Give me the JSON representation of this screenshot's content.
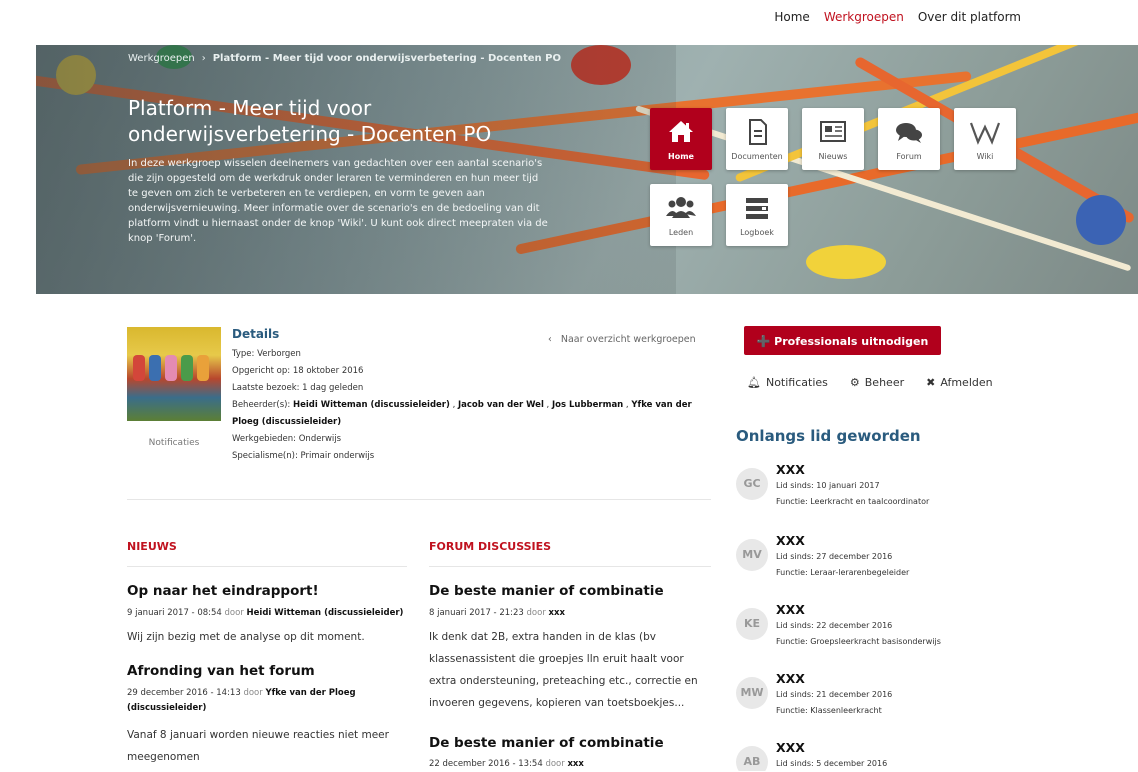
{
  "topnav": {
    "items": [
      "Home",
      "Werkgroepen",
      "Over dit platform"
    ],
    "active": "Werkgroepen"
  },
  "breadcrumb": {
    "root": "Werkgroepen",
    "separator": "›",
    "current": "Platform - Meer tijd voor onderwijsverbetering - Docenten PO"
  },
  "hero": {
    "title": "Platform - Meer tijd voor onderwijsverbetering - Docenten PO",
    "description": "In deze werkgroep wisselen deelnemers van gedachten over een aantal scenario's die zijn opgesteld om de werkdruk onder leraren te verminderen en hun meer tijd te geven om zich te verbeteren en te verdiepen, en vorm te geven aan onderwijsvernieuwing. Meer informatie over de scenario's en de bedoeling van dit platform vindt u hiernaast onder de knop 'Wiki'. U kunt ook direct meepraten via de knop 'Forum'."
  },
  "tiles": [
    {
      "label": "Home",
      "icon": "home-icon",
      "active": true
    },
    {
      "label": "Documenten",
      "icon": "document-icon",
      "active": false
    },
    {
      "label": "Nieuws",
      "icon": "newspaper-icon",
      "active": false
    },
    {
      "label": "Forum",
      "icon": "chat-bubbles-icon",
      "active": false
    },
    {
      "label": "Wiki",
      "icon": "wiki-icon",
      "active": false
    },
    {
      "label": "Leden",
      "icon": "users-icon",
      "active": false
    },
    {
      "label": "Logboek",
      "icon": "logbook-icon",
      "active": false
    }
  ],
  "details": {
    "title": "Details",
    "photo_caption": "Notificaties",
    "type": "Type: Verborgen",
    "founded": "Opgericht op: 18 oktober 2016",
    "last_visit": "Laatste bezoek: 1 dag geleden",
    "admins_label": "Beheerder(s):",
    "admins": [
      "Heidi Witteman (discussieleider)",
      "Jacob van der Wel",
      "Jos Lubberman",
      "Yfke van der Ploeg (discussieleider)"
    ],
    "areas": "Werkgebieden: Onderwijs",
    "specialism": "Specialisme(n): Primair onderwijs",
    "back_link": "Naar overzicht werkgroepen",
    "back_chevron": "‹"
  },
  "news": {
    "heading": "NIEUWS",
    "items": [
      {
        "title": "Op naar het eindrapport!",
        "date": "9 januari 2017 - 08:54",
        "by": "door",
        "author": "Heidi Witteman (discussieleider)",
        "body": "Wij zijn bezig met de analyse op dit moment."
      },
      {
        "title": "Afronding van het forum",
        "date": "29 december 2016 - 14:13",
        "by": "door",
        "author": "Yfke van der Ploeg (discussieleider)",
        "body": "Vanaf 8 januari worden nieuwe reacties niet meer meegenomen"
      }
    ]
  },
  "forum": {
    "heading": "FORUM DISCUSSIES",
    "items": [
      {
        "title": "De beste manier of combinatie",
        "date": "8 januari 2017 - 21:23",
        "by": "door",
        "author": "xxx",
        "body": "Ik denk dat 2B, extra handen in de klas (bv klassenassistent die groepjes lln eruit haalt voor extra ondersteuning, preteaching etc., correctie en invoeren gegevens, kopieren van toetsboekjes..."
      },
      {
        "title": "De beste manier of combinatie",
        "date": "22 december 2016 - 13:54",
        "by": "door",
        "author": "xxx"
      }
    ]
  },
  "sidebar": {
    "invite_label": "Professionals uitnodigen",
    "actions": [
      {
        "label": "Notificaties",
        "icon": "bell-icon"
      },
      {
        "label": "Beheer",
        "icon": "gears-icon"
      },
      {
        "label": "Afmelden",
        "icon": "user-remove-icon"
      }
    ],
    "members_title": "Onlangs lid geworden",
    "members": [
      {
        "initials": "GC",
        "name": "XXX",
        "since": "Lid sinds: 10 januari 2017",
        "function": "Functie: Leerkracht en taalcoordinator"
      },
      {
        "initials": "MV",
        "name": "XXX",
        "since": "Lid sinds: 27 december 2016",
        "function": "Functie: Leraar-lerarenbegeleider"
      },
      {
        "initials": "KE",
        "name": "XXX",
        "since": "Lid sinds: 22 december 2016",
        "function": "Functie: Groepsleerkracht basisonderwijs"
      },
      {
        "initials": "MW",
        "name": "XXX",
        "since": "Lid sinds: 21 december 2016",
        "function": "Functie: Klassenleerkracht"
      },
      {
        "initials": "AB",
        "name": "XXX",
        "since": "Lid sinds: 5 december 2016",
        "function": ""
      }
    ]
  }
}
